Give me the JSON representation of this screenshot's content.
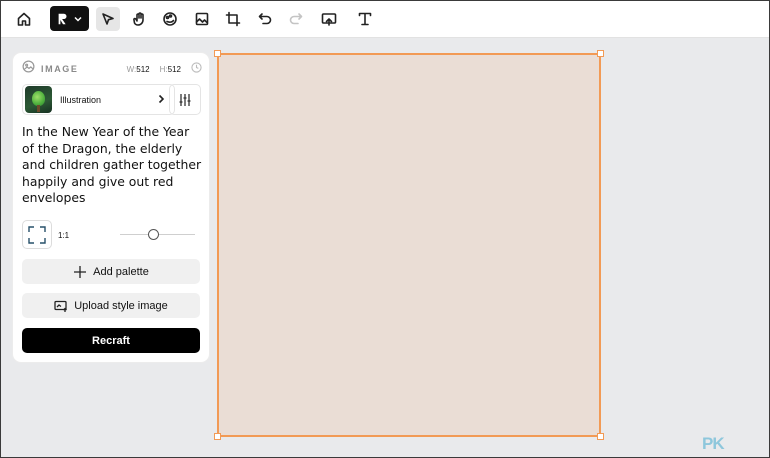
{
  "toolbar": {
    "items": [
      {
        "icon": "home-icon"
      },
      {
        "icon": "recraft-logo-icon"
      },
      {
        "icon": "select-pointer-icon"
      },
      {
        "icon": "hand-icon"
      },
      {
        "icon": "palette-icon"
      },
      {
        "icon": "image-frame-icon"
      },
      {
        "icon": "crop-icon"
      },
      {
        "icon": "undo-icon"
      },
      {
        "icon": "redo-icon"
      },
      {
        "icon": "upload-image-icon"
      },
      {
        "icon": "text-tool-icon"
      }
    ]
  },
  "panel": {
    "title": "IMAGE",
    "width_label": "W:",
    "width_value": "512",
    "height_label": "H:",
    "height_value": "512",
    "style_name": "Illustration",
    "prompt": "In the New Year of the Year of the Dragon, the elderly and children gather together happily and give out red envelopes",
    "aspect_ratio": "1:1",
    "slider_level": 0.45,
    "add_palette_label": "Add palette",
    "upload_style_label": "Upload style image",
    "recraft_label": "Recraft"
  },
  "canvas": {
    "fill_color": "#eaddd5",
    "border_color": "#f29a55"
  },
  "watermark": "PK"
}
